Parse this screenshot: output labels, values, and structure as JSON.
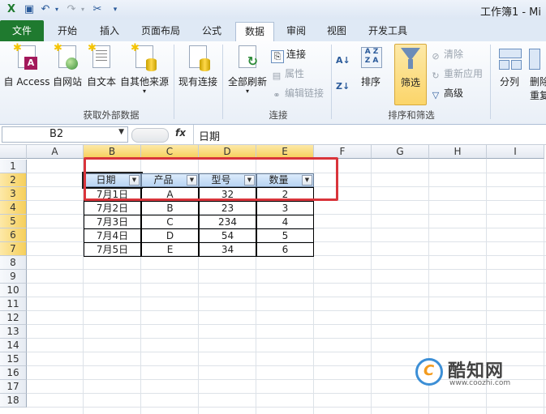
{
  "window": {
    "title": "工作簿1 - Mi"
  },
  "tabs": [
    {
      "label": "文件"
    },
    {
      "label": "开始"
    },
    {
      "label": "插入"
    },
    {
      "label": "页面布局"
    },
    {
      "label": "公式"
    },
    {
      "label": "数据"
    },
    {
      "label": "审阅"
    },
    {
      "label": "视图"
    },
    {
      "label": "开发工具"
    }
  ],
  "ribbon": {
    "external": {
      "access": "自 Access",
      "web": "自网站",
      "text": "自文本",
      "other": "自其他来源",
      "existing": "现有连接",
      "group_label": "获取外部数据"
    },
    "connections": {
      "refresh_all": "全部刷新",
      "connections": "连接",
      "properties": "属性",
      "edit_links": "编辑链接",
      "group_label": "连接"
    },
    "sort_filter": {
      "sort": "排序",
      "filter": "筛选",
      "clear": "清除",
      "reapply": "重新应用",
      "advanced": "高级",
      "group_label": "排序和筛选"
    },
    "tools": {
      "split": "分列",
      "remove": "删除",
      "remove2": "重复"
    }
  },
  "formula_bar": {
    "cell_ref": "B2",
    "fx": "fx",
    "value": "日期"
  },
  "columns": [
    "A",
    "B",
    "C",
    "D",
    "E",
    "F",
    "G",
    "H",
    "I"
  ],
  "rows": [
    "1",
    "2",
    "3",
    "4",
    "5",
    "6",
    "7",
    "8",
    "9",
    "10",
    "11",
    "12",
    "13",
    "14",
    "15",
    "16",
    "17",
    "18"
  ],
  "table": {
    "headers": [
      "日期",
      "产品",
      "型号",
      "数量"
    ],
    "rows": [
      [
        "7月1日",
        "A",
        "32",
        "2"
      ],
      [
        "7月2日",
        "B",
        "23",
        "3"
      ],
      [
        "7月3日",
        "C",
        "234",
        "4"
      ],
      [
        "7月4日",
        "D",
        "54",
        "5"
      ],
      [
        "7月5日",
        "E",
        "34",
        "6"
      ]
    ]
  },
  "watermark": {
    "name": "酷知网",
    "url": "www.coozhi.com"
  },
  "colors": {
    "file_tab": "#1f7a2f",
    "highlight": "#d9343b",
    "filter_active": "#fbd56a"
  }
}
